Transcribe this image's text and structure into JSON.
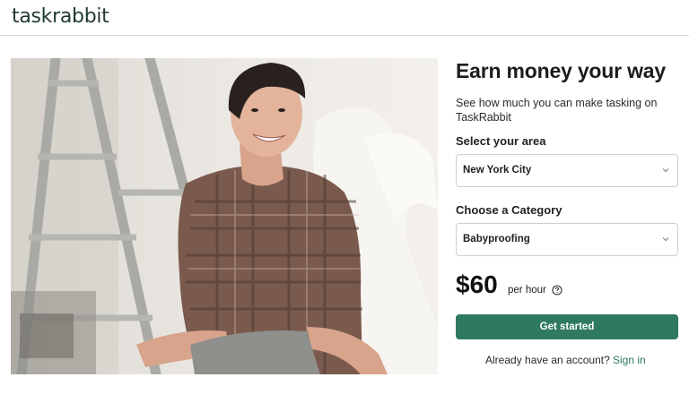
{
  "header": {
    "logo_text": "taskrabbit"
  },
  "hero": {
    "image_alt": "smiling woman in plaid shirt sitting by a ladder"
  },
  "panel": {
    "headline": "Earn money your way",
    "subtext": "See how much you can make tasking on TaskRabbit",
    "area_label": "Select your area",
    "area_value": "New York City",
    "category_label": "Choose a Category",
    "category_value": "Babyproofing",
    "price": "$60",
    "per_hour": "per hour",
    "cta_label": "Get started",
    "account_prompt": "Already have an account?",
    "signin_label": "Sign in"
  },
  "colors": {
    "brand_green": "#2f7a5e",
    "logo_green": "#1f3a2f",
    "border": "#cfcfcf"
  },
  "icons": {
    "chevron": "chevron-down-icon",
    "help": "question-circle-icon"
  }
}
